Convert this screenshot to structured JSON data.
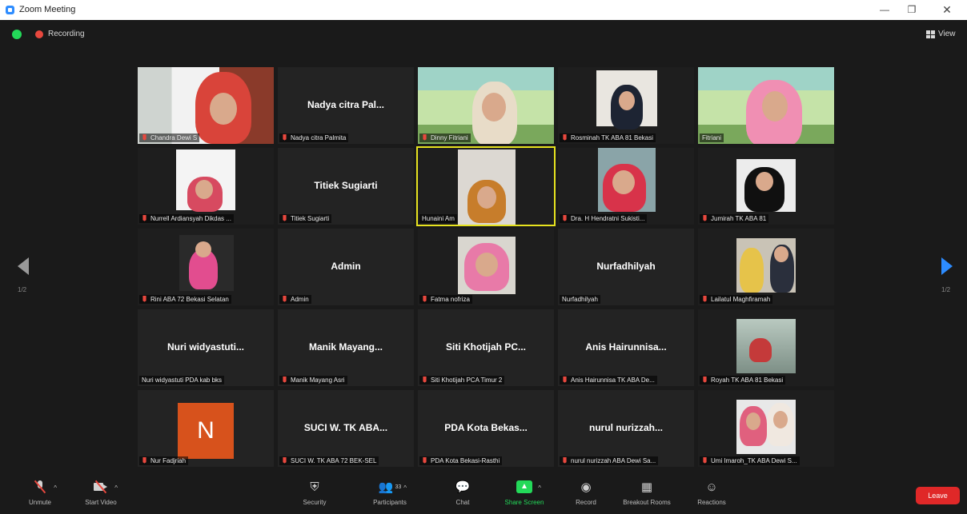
{
  "window": {
    "title": "Zoom Meeting",
    "min": "—",
    "max": "❐",
    "close": "✕"
  },
  "topbar": {
    "recording_label": "Recording",
    "view_label": "View"
  },
  "pager": {
    "left": "1/2",
    "right": "1/2"
  },
  "tiles": [
    {
      "label": "Chandra Dewi S"
    },
    {
      "center": "Nadya citra Pal...",
      "label": "Nadya citra Palmita"
    },
    {
      "label": "Dinny Fitriani"
    },
    {
      "label": "Rosminah TK ABA 81 Bekasi"
    },
    {
      "label": "Fitriani"
    },
    {
      "label": "Nurrell Ardiansyah Dikdas ..."
    },
    {
      "center": "Titiek Sugiarti",
      "label": "Titiek Sugiarti"
    },
    {
      "label": "Hunaini Am"
    },
    {
      "label": "Dra. H Hendratni Sukisti..."
    },
    {
      "label": "Jumirah TK ABA 81"
    },
    {
      "label": "Rini ABA 72 Bekasi Selatan"
    },
    {
      "center": "Admin",
      "label": "Admin"
    },
    {
      "label": "Fatma nofriza"
    },
    {
      "center": "Nurfadhilyah",
      "label": "Nurfadhilyah"
    },
    {
      "label": "Lailatul Maghfiramah"
    },
    {
      "center": "Nuri widyastuti...",
      "label": "Nuri widyastuti PDA kab bks"
    },
    {
      "center": "Manik Mayang...",
      "label": "Manik Mayang Asri"
    },
    {
      "center": "Siti Khotijah PC...",
      "label": "Siti Khotijah PCA Timur 2"
    },
    {
      "center": "Anis Hairunnisa...",
      "label": "Anis Hairunnisa TK ABA De..."
    },
    {
      "label": "Royah TK ABA 81 Bekasi"
    },
    {
      "avatar_letter": "N",
      "label": "Nur Fadjriah"
    },
    {
      "center": "SUCI W. TK ABA...",
      "label": "SUCI W. TK ABA 72 BEK-SEL"
    },
    {
      "center": "PDA Kota Bekas...",
      "label": "PDA Kota Bekasi-Rasthi"
    },
    {
      "center": "nurul nurizzah...",
      "label": "nurul nurizzah ABA Dewi Sa..."
    },
    {
      "label": "Umi Imaroh_TK ABA Dewi S..."
    }
  ],
  "toolbar": {
    "unmute": "Unmute",
    "start_video": "Start Video",
    "security": "Security",
    "participants": "Participants",
    "participants_count": "33",
    "chat": "Chat",
    "share_screen": "Share Screen",
    "record": "Record",
    "breakout_rooms": "Breakout Rooms",
    "reactions": "Reactions",
    "leave": "Leave",
    "caret": "^"
  },
  "colors": {
    "accent": "#2d8cff",
    "active_speaker": "#e7e31f",
    "leave": "#e02828",
    "share": "#23d959",
    "muted": "#e8483e"
  }
}
